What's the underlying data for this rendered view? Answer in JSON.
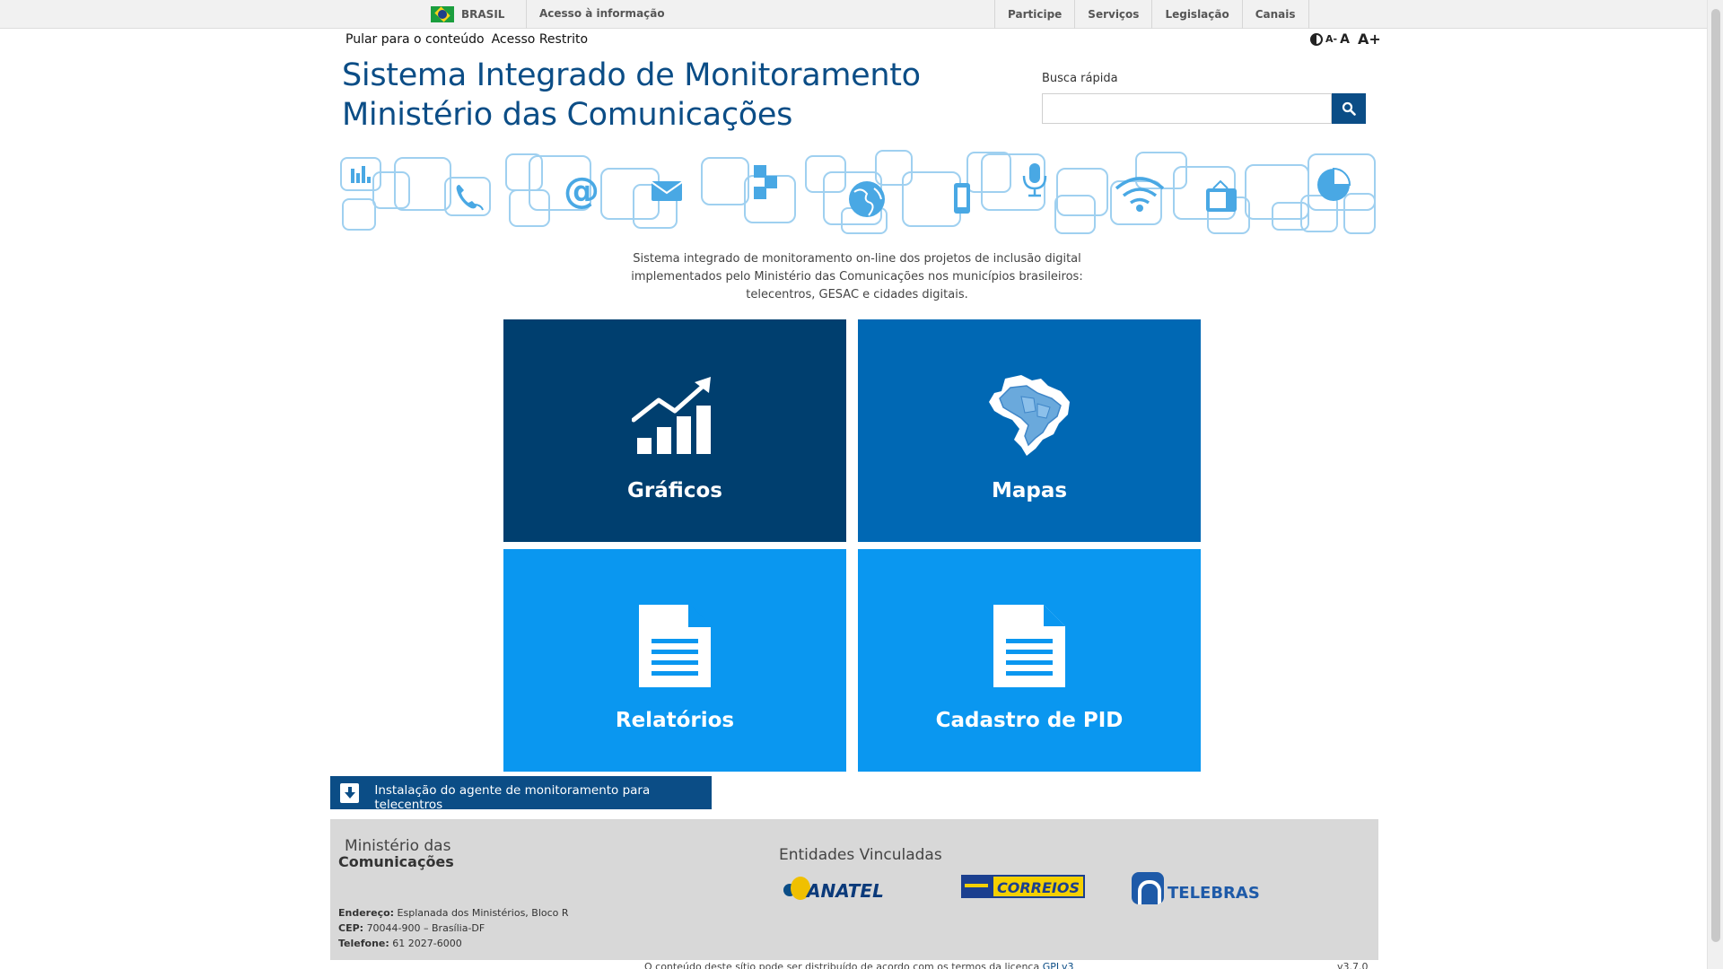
{
  "govbar": {
    "country": "BRASIL",
    "access_info": "Acesso à informação",
    "menu": [
      "Participe",
      "Serviços",
      "Legislação",
      "Canais"
    ]
  },
  "header": {
    "skip_link": "Pular para o conteúdo",
    "restricted_link": "Acesso Restrito",
    "font_small": "A-",
    "font_normal": "A",
    "font_large": "A+",
    "title_line1": "Sistema Integrado de Monitoramento",
    "title_line2": "Ministério das Comunicações",
    "search_label": "Busca rápida",
    "search_value": ""
  },
  "intro": {
    "line1": "Sistema integrado de monitoramento on-line dos projetos de inclusão digital",
    "line2": "implementados pelo Ministério das Comunicações nos municípios brasileiros:",
    "line3": "telecentros, GESAC e cidades digitais."
  },
  "tiles": [
    {
      "label": "Gráficos",
      "icon": "growth-chart-icon",
      "color": "#003f6f"
    },
    {
      "label": "Mapas",
      "icon": "brazil-map-icon",
      "color": "#0068b4"
    },
    {
      "label": "Relatórios",
      "icon": "document-icon",
      "color": "#0a97f0"
    },
    {
      "label": "Cadastro de PID",
      "icon": "document-icon",
      "color": "#0a97f0"
    }
  ],
  "agent_bar": {
    "label": "Instalação do agente de monitoramento para telecentros",
    "icon": "download-icon"
  },
  "footer": {
    "ministry_line1": "Ministério das",
    "ministry_line2": "Comunicações",
    "address_label": "Endereço:",
    "address_value": "Esplanada dos Ministérios, Bloco R",
    "cep_label": "CEP:",
    "cep_value": "70044-900 – Brasília-DF",
    "phone_label": "Telefone:",
    "phone_value": "61 2027-6000",
    "entities_title": "Entidades Vinculadas",
    "entities": [
      "ANATEL",
      "CORREIOS",
      "TELEBRAS"
    ],
    "license_text": "O conteúdo deste sítio pode ser distribuído de acordo com os termos da licença",
    "license_link": "GPLv3",
    "version": "v3.7.0"
  },
  "colors": {
    "primary": "#0b4d86",
    "tile_dark": "#003f6f",
    "tile_mid": "#0068b4",
    "tile_light": "#0a97f0",
    "banner_stroke": "#9fd0f0",
    "banner_icon": "#49a8e4",
    "footer_bg": "#d8d8d8"
  }
}
